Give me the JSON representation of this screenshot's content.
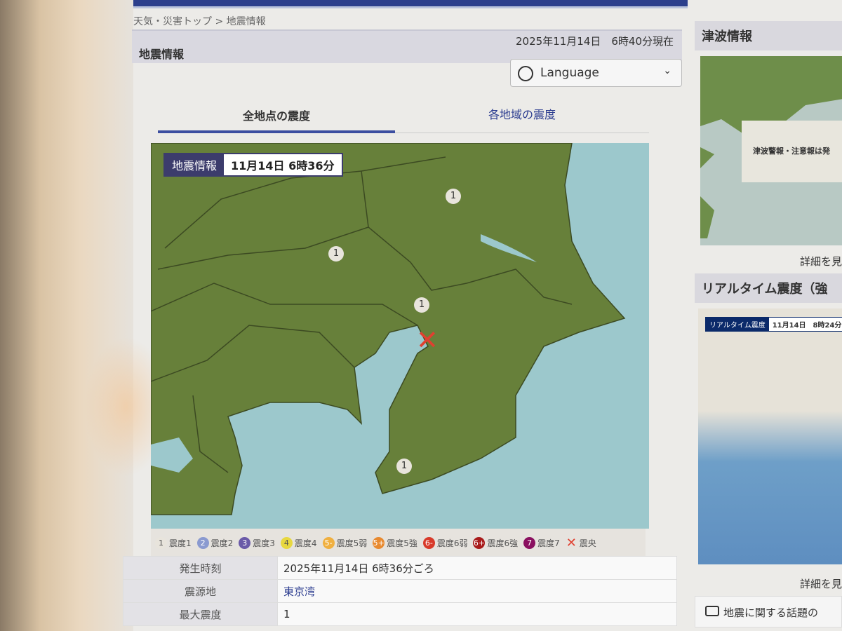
{
  "breadcrumb": "天気・災害トップ > 地震情報",
  "header": {
    "title": "地震情報",
    "datetime": "2025年11月14日　6時40分現在"
  },
  "language": {
    "label": "Language"
  },
  "tabs": [
    {
      "label": "全地点の震度"
    },
    {
      "label": "各地域の震度"
    }
  ],
  "map": {
    "badge_label": "地震情報",
    "badge_time": "11月14日 6時36分",
    "markers": [
      "1",
      "1",
      "1",
      "1"
    ]
  },
  "legend": [
    {
      "mark": "1",
      "label": "震度1",
      "color": "#e8e4dc"
    },
    {
      "mark": "2",
      "label": "震度2",
      "color": "#8a9ad0"
    },
    {
      "mark": "3",
      "label": "震度3",
      "color": "#6a5aa8"
    },
    {
      "mark": "4",
      "label": "震度4",
      "color": "#e8d840"
    },
    {
      "mark": "5-",
      "label": "震度5弱",
      "color": "#f0b040"
    },
    {
      "mark": "5+",
      "label": "震度5強",
      "color": "#e88a30"
    },
    {
      "mark": "6-",
      "label": "震度6弱",
      "color": "#d83a2a"
    },
    {
      "mark": "6+",
      "label": "震度6強",
      "color": "#a81a1a"
    },
    {
      "mark": "7",
      "label": "震度7",
      "color": "#8a1060"
    },
    {
      "mark": "✕",
      "label": "震央",
      "color": "#e04030"
    }
  ],
  "details": [
    {
      "label": "発生時刻",
      "value": "2025年11月14日 6時36分ごろ"
    },
    {
      "label": "震源地",
      "value": "東京湾"
    },
    {
      "label": "最大震度",
      "value": "1"
    }
  ],
  "sidebar": {
    "tsunami_title": "津波情報",
    "tsunami_message": "津波警報・注意報は発",
    "more1": "詳細を見",
    "realtime_title": "リアルタイム震度（強",
    "realtime_badge": "リアルタイム震度",
    "realtime_time": "11月14日　8時24分",
    "more2": "詳細を見",
    "talk": "地震に関する話題の"
  }
}
